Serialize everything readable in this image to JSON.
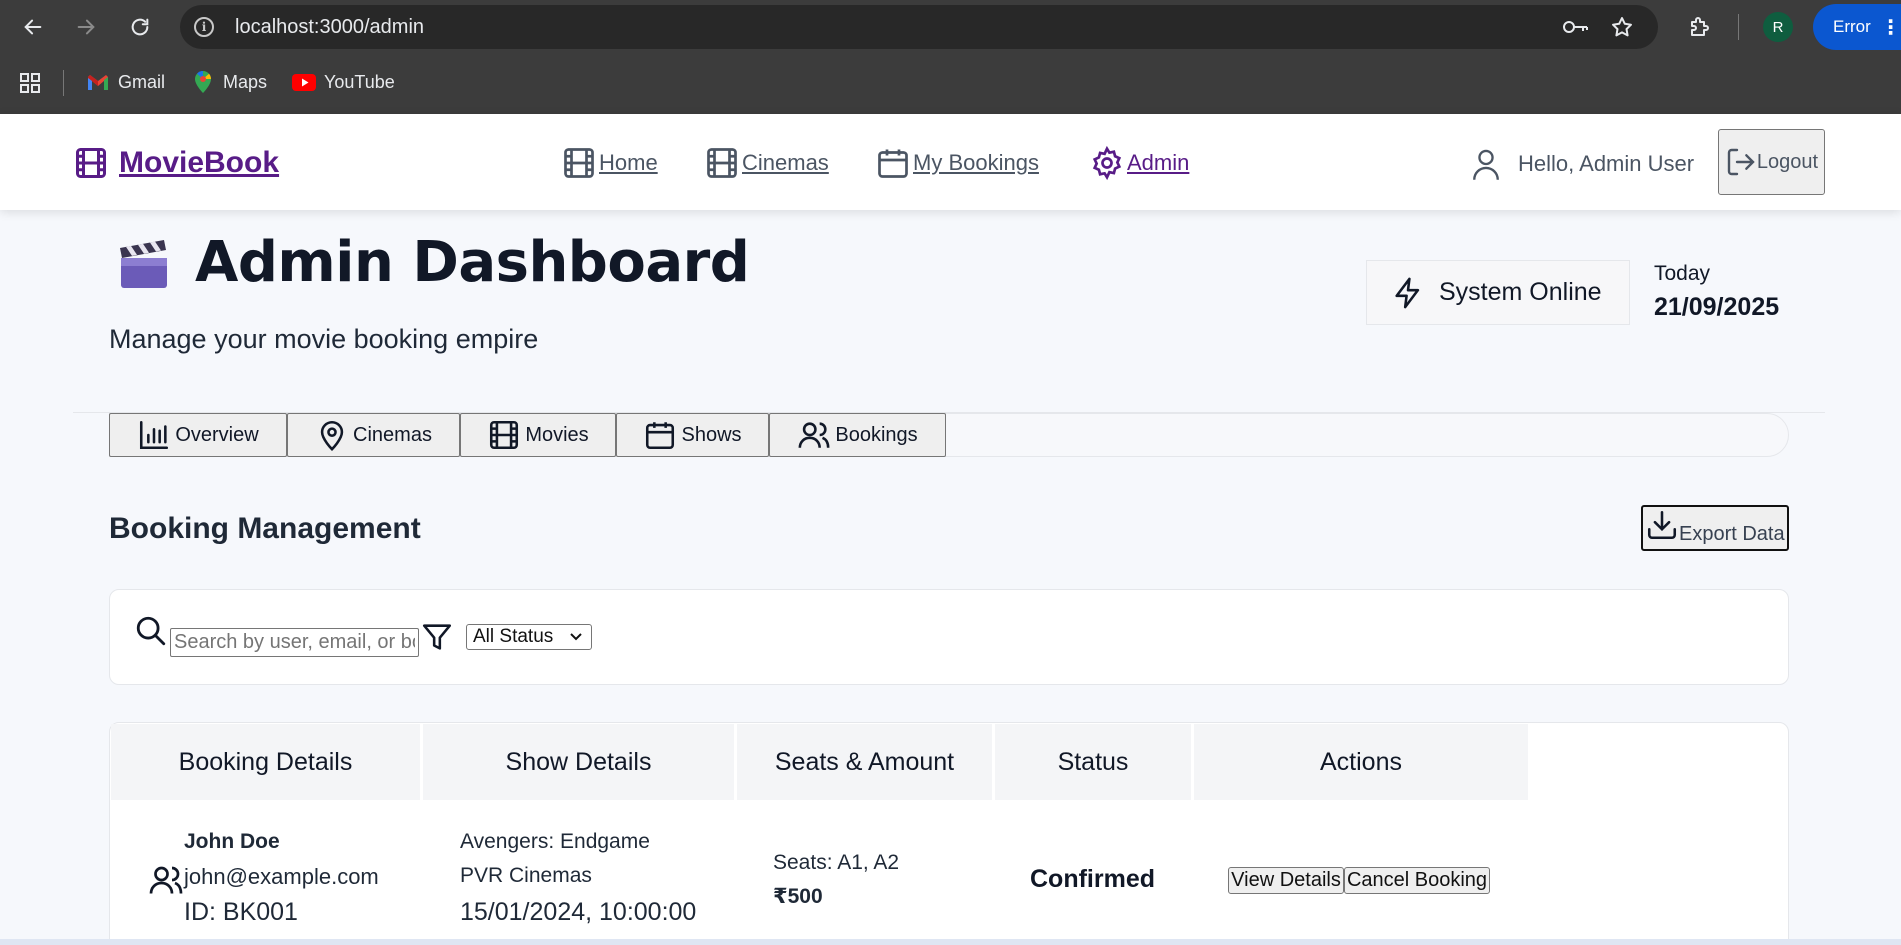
{
  "browser": {
    "url": "localhost:3000/admin",
    "profile_initial": "R",
    "error_label": "Error",
    "bookmarks": [
      {
        "label": "Gmail",
        "icon": "gmail-icon"
      },
      {
        "label": "Maps",
        "icon": "maps-icon"
      },
      {
        "label": "YouTube",
        "icon": "youtube-icon"
      }
    ]
  },
  "header": {
    "brand": "MovieBook",
    "nav": [
      {
        "label": "Home",
        "icon": "film-icon"
      },
      {
        "label": "Cinemas",
        "icon": "film-icon"
      },
      {
        "label": "My Bookings",
        "icon": "calendar-icon"
      },
      {
        "label": "Admin",
        "icon": "gear-icon"
      }
    ],
    "greeting": "Hello, Admin User",
    "logout_label": "Logout"
  },
  "page": {
    "title": "Admin Dashboard",
    "subtitle": "Manage your movie booking empire",
    "system_status": "System Online",
    "today_label": "Today",
    "today_date": "21/09/2025"
  },
  "tabs": [
    "Overview",
    "Cinemas",
    "Movies",
    "Shows",
    "Bookings"
  ],
  "section": {
    "title": "Booking Management",
    "export_label": "Export Data",
    "search_placeholder": "Search by user, email, or booking ID",
    "status_filter": "All Status"
  },
  "table": {
    "headers": [
      "Booking Details",
      "Show Details",
      "Seats & Amount",
      "Status",
      "Actions"
    ],
    "rows": [
      {
        "user": "John Doe",
        "email": "john@example.com",
        "booking_id": "ID: BK001",
        "movie": "Avengers: Endgame",
        "cinema": "PVR Cinemas",
        "datetime": "15/01/2024, 10:00:00",
        "seats": "Seats: A1, A2",
        "amount": "₹500",
        "status": "Confirmed",
        "actions": [
          "View Details",
          "Cancel Booking"
        ]
      }
    ]
  },
  "colors": {
    "brand": "#581c87",
    "chrome_bg": "#3c3c3c",
    "error_pill": "#0b57d0"
  }
}
